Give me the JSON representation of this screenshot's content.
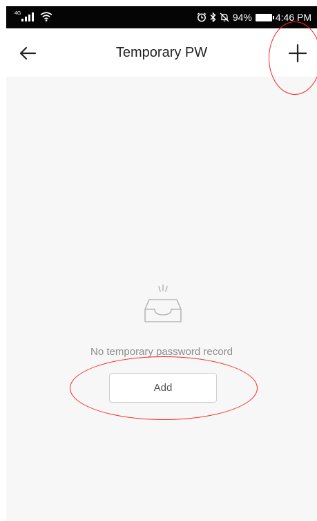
{
  "status_bar": {
    "network": "4G",
    "battery_percent": "94%",
    "time": "4:46 PM",
    "icons": [
      "signal-icon",
      "wifi-icon",
      "alarm-icon",
      "bluetooth-icon",
      "mute-icon",
      "battery-icon"
    ]
  },
  "header": {
    "title": "Temporary PW",
    "back_icon": "arrow-left-icon",
    "add_icon": "plus-icon"
  },
  "empty_state": {
    "icon": "empty-inbox-icon",
    "message": "No temporary password record",
    "button_label": "Add"
  },
  "annotations": {
    "color": "#ff2222"
  }
}
